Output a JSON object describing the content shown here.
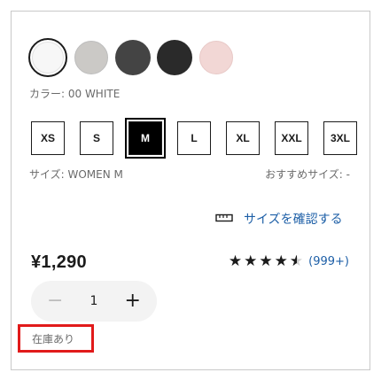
{
  "colors": {
    "swatches": [
      {
        "name": "00 WHITE",
        "hex": "#f7f7f7",
        "selected": true
      },
      {
        "name": "light-gray",
        "hex": "#cbc9c6"
      },
      {
        "name": "dark-gray",
        "hex": "#444444"
      },
      {
        "name": "black",
        "hex": "#2a2a2a"
      },
      {
        "name": "pink",
        "hex": "#f2d7d5"
      }
    ],
    "label": "カラー: 00 WHITE"
  },
  "sizes": {
    "options": [
      "XS",
      "S",
      "M",
      "L",
      "XL",
      "XXL",
      "3XL"
    ],
    "selected": "M",
    "label": "サイズ: WOMEN M",
    "recommended": "おすすめサイズ: -"
  },
  "size_check": {
    "label": "サイズを確認する",
    "icon": "ruler-icon"
  },
  "price": "¥1,290",
  "rating": {
    "stars": 4.5,
    "count": "(999+)"
  },
  "quantity": {
    "value": "1",
    "minus": "−",
    "plus": "+"
  },
  "stock": "在庫あり"
}
